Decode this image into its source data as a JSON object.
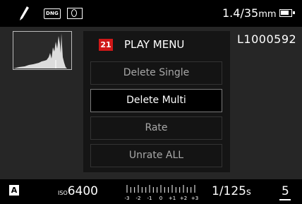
{
  "top_bar": {
    "file_format": "DNG",
    "lens_aperture": "1.4",
    "lens_separator": "/",
    "lens_focal": "35",
    "lens_unit": "mm",
    "icons": [
      "profile-pen-icon",
      "dng-format-icon",
      "metering-icon",
      "battery-icon"
    ]
  },
  "image_id": "L1000592",
  "menu": {
    "page_number": "21",
    "title": "PLAY MENU",
    "items": [
      {
        "label": "Delete Single",
        "selected": false
      },
      {
        "label": "Delete Multi",
        "selected": true
      },
      {
        "label": "Rate",
        "selected": false
      },
      {
        "label": "Unrate ALL",
        "selected": false
      }
    ],
    "accent_color": "#d01818"
  },
  "bottom_bar": {
    "exposure_mode": "A",
    "iso_label": "ISO",
    "iso_value": "6400",
    "ev_scale_labels": [
      "-3",
      "-2",
      "-1",
      "0",
      "+1",
      "+2",
      "+3"
    ],
    "shutter_value": "1/125",
    "shutter_unit": "s",
    "shots_remaining": "5"
  }
}
